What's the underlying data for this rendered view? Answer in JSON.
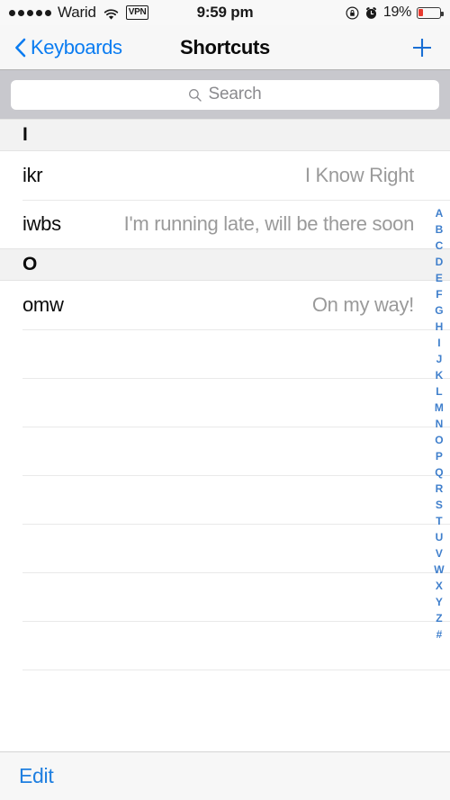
{
  "status_bar": {
    "signal_dots_filled": 5,
    "carrier": "Warid",
    "wifi_icon": "wifi-icon",
    "vpn_label": "VPN",
    "time": "9:59 pm",
    "rotation_lock_icon": "rotation-lock-icon",
    "alarm_icon": "alarm-clock-icon",
    "battery_percent": "19%",
    "battery_level": 19,
    "battery_color": "#e8392e"
  },
  "nav_bar": {
    "back_icon": "chevron-left-icon",
    "back_label": "Keyboards",
    "title": "Shortcuts",
    "add_icon": "plus-icon",
    "tint_color": "#0a7cf1"
  },
  "search": {
    "icon": "search-icon",
    "placeholder": "Search",
    "value": ""
  },
  "list": {
    "sections": [
      {
        "header": "I",
        "rows": [
          {
            "phrase": "ikr",
            "expansion": "I Know Right"
          },
          {
            "phrase": "iwbs",
            "expansion": "I'm running late, will be there soon"
          }
        ]
      },
      {
        "header": "O",
        "rows": [
          {
            "phrase": "omw",
            "expansion": "On my way!"
          }
        ]
      }
    ],
    "empty_row_count": 8
  },
  "section_index": {
    "letters": [
      "A",
      "B",
      "C",
      "D",
      "E",
      "F",
      "G",
      "H",
      "I",
      "J",
      "K",
      "L",
      "M",
      "N",
      "O",
      "P",
      "Q",
      "R",
      "S",
      "T",
      "U",
      "V",
      "W",
      "X",
      "Y",
      "Z",
      "#"
    ],
    "color": "#3f7fcc"
  },
  "toolbar": {
    "edit_label": "Edit",
    "tint_color": "#1f7fe0"
  }
}
